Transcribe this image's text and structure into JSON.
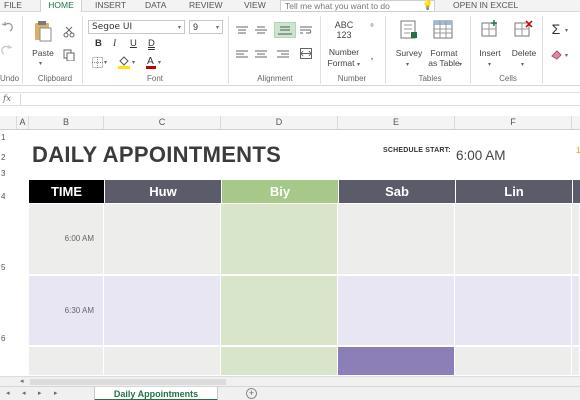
{
  "menu": {
    "items": [
      "FILE",
      "HOME",
      "INSERT",
      "DATA",
      "REVIEW",
      "VIEW"
    ],
    "tell_me": "Tell me what you want to do",
    "open_in_excel": "OPEN IN EXCEL"
  },
  "ribbon": {
    "undo_label": "Undo",
    "clipboard": {
      "paste_label": "Paste",
      "group_label": "Clipboard"
    },
    "font": {
      "family": "Segoe UI",
      "size": "9",
      "bold": "B",
      "italic": "I",
      "underline": "U",
      "double_underline": "D",
      "group_label": "Font"
    },
    "alignment": {
      "group_label": "Alignment"
    },
    "number": {
      "icon_text": "ABC\n123",
      "label_line1": "Number",
      "label_line2": "Format",
      "group_label": "Number"
    },
    "tables": {
      "survey_label": "Survey",
      "format_line1": "Format",
      "format_line2": "as Table",
      "group_label": "Tables"
    },
    "cells": {
      "insert_label": "Insert",
      "delete_label": "Delete",
      "group_label": "Cells"
    },
    "editing": {
      "sum_symbol": "Σ"
    }
  },
  "formula_bar": {
    "fx_label": "fx",
    "value": ""
  },
  "columns": [
    "A",
    "B",
    "C",
    "D",
    "E",
    "F"
  ],
  "rows": [
    "1",
    "2",
    "3",
    "4",
    "5",
    "6"
  ],
  "sheet": {
    "title": "DAILY APPOINTMENTS",
    "schedule_start_label": "SCHEDULE START:",
    "schedule_start_value": "6:00 AM",
    "extra_fragment": "1",
    "headers": [
      "TIME",
      "Huw",
      "Biy",
      "Sab",
      "Lin"
    ],
    "time_slots": [
      "6:00 AM",
      "6:30 AM",
      ""
    ]
  },
  "tabs": {
    "active": "Daily Appointments",
    "add_symbol": "+"
  },
  "colors": {
    "accent": "#217346",
    "time_header": "#000000",
    "name_header": "#5b5b69",
    "highlight_header": "#a6c98a",
    "row_gray": "#ededeb",
    "row_lavender": "#e8e6f2",
    "green_column": "#d9e5ca",
    "purple_block": "#8c7fb7"
  }
}
